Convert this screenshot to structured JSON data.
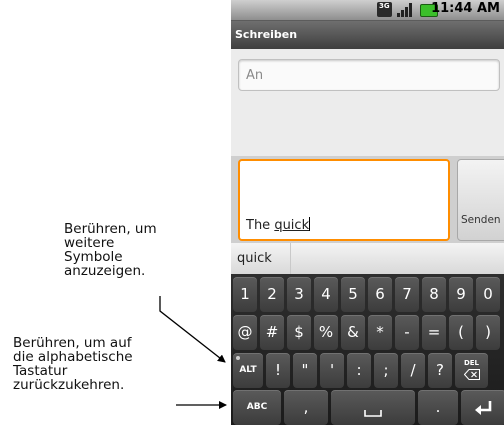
{
  "annotations": {
    "more_symbols": "Berühren, um\nweitere\nSymbole\nanzuzeigen.",
    "alphabetic": "Berühren, um auf\ndie alphabetische\nTastatur\nzurückzukehren."
  },
  "status_bar": {
    "time": "11:44 AM",
    "network_badge": "3G",
    "icons": [
      "3g-icon",
      "signal-icon",
      "battery-icon"
    ]
  },
  "app": {
    "title": "Schreiben"
  },
  "compose": {
    "to_placeholder": "An",
    "message_prefix": "The ",
    "message_word": "quick",
    "send_label": "Senden"
  },
  "suggestions": [
    "quick"
  ],
  "keyboard": {
    "row1": [
      "1",
      "2",
      "3",
      "4",
      "5",
      "6",
      "7",
      "8",
      "9",
      "0"
    ],
    "row2": [
      "@",
      "#",
      "$",
      "%",
      "&",
      "*",
      "-",
      "=",
      "(",
      ")"
    ],
    "row3": {
      "alt": "ALT",
      "keys": [
        "!",
        "\"",
        "'",
        ":",
        ";",
        "/",
        "?"
      ],
      "del": "DEL"
    },
    "row4": {
      "abc": "ABC",
      "comma": ",",
      "space_icon": "space-bar-icon",
      "period": ".",
      "enter_icon": "enter-icon"
    }
  },
  "colors": {
    "focus_border": "#ff8d00",
    "battery": "#3bbf2a",
    "keyboard_bg": "#1b1b1b",
    "key_bg": "#4a4a4a"
  }
}
